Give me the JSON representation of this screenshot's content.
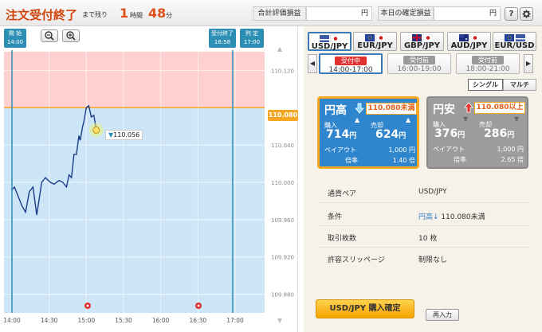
{
  "header": {
    "title": "注文受付終了",
    "remaining_label": "まで残り",
    "hours": "1",
    "hours_unit": "時間",
    "minutes": "48",
    "minutes_unit": "分",
    "total_pl_label": "合計評価損益",
    "total_pl_value": "円",
    "today_pl_label": "本日の確定損益",
    "today_pl_value": "円",
    "help_label": "?",
    "settings_icon": "gear-icon"
  },
  "chart": {
    "zoom_out_icon": "zoom-out-icon",
    "zoom_in_icon": "zoom-in-icon",
    "start_marker": {
      "label": "開 始",
      "time": "14:00"
    },
    "end_accept_marker": {
      "label": "受付終了",
      "time": "16:58"
    },
    "judge_marker": {
      "label": "判 定",
      "time": "17:00"
    },
    "current_rate": "110.080",
    "entry_rate": "110.056",
    "y_ticks": [
      "110.120",
      "110.080",
      "110.040",
      "110.000",
      "109.960",
      "109.920",
      "109.880"
    ],
    "x_ticks": [
      "14:00",
      "14:30",
      "15:00",
      "15:30",
      "16:00",
      "16:30",
      "17:00"
    ],
    "colors": {
      "upper_zone": "#ffd0d0",
      "lower_zone": "#cde6f7",
      "line": "#1a3a8a",
      "marker": "#2e8fb5",
      "threshold": "#f5a623"
    }
  },
  "chart_data": {
    "type": "line",
    "title": "",
    "xlabel": "",
    "ylabel": "",
    "ylim": [
      109.86,
      110.14
    ],
    "x": [
      "14:00",
      "14:02",
      "14:05",
      "14:08",
      "14:11",
      "14:14",
      "14:17",
      "14:20",
      "14:24",
      "14:27",
      "14:31",
      "14:34",
      "14:38",
      "14:41",
      "14:44",
      "14:46",
      "14:48",
      "14:50",
      "14:52",
      "14:54",
      "14:55",
      "14:57",
      "14:58",
      "15:00",
      "15:02",
      "15:04",
      "15:06",
      "15:08"
    ],
    "values": [
      109.992,
      109.995,
      109.985,
      109.975,
      109.968,
      109.99,
      109.995,
      109.965,
      110.0,
      110.005,
      110.0,
      109.998,
      110.002,
      110.0,
      109.995,
      110.008,
      110.005,
      110.03,
      110.03,
      110.05,
      110.045,
      110.06,
      110.065,
      110.08,
      110.082,
      110.07,
      110.072,
      110.056
    ],
    "threshold": 110.08
  },
  "currency_pairs": [
    {
      "label": "USD/JPY",
      "selected": true
    },
    {
      "label": "EUR/JPY",
      "selected": false
    },
    {
      "label": "GBP/JPY",
      "selected": false
    },
    {
      "label": "AUD/JPY",
      "selected": false
    },
    {
      "label": "EUR/USD",
      "selected": false
    }
  ],
  "sessions": [
    {
      "status": "受付中",
      "time": "14:00-17:00",
      "selected": true
    },
    {
      "status": "受付前",
      "time": "16:00-19:00",
      "selected": false
    },
    {
      "status": "受付前",
      "time": "18:00-21:00",
      "selected": false
    }
  ],
  "mode": {
    "single": "シングル",
    "multi": "マルチ"
  },
  "high_card": {
    "title": "円高",
    "threshold": "110.080未満",
    "buy_label": "購入",
    "sell_label": "売却",
    "buy_price": "714",
    "sell_price": "624",
    "yen": "円",
    "payout_label": "ペイアウト",
    "payout_value": "1,000 円",
    "ratio_label": "倍率",
    "ratio_value": "1.40 倍"
  },
  "low_card": {
    "title": "円安",
    "threshold": "110.080以上",
    "buy_label": "購入",
    "sell_label": "売却",
    "buy_price": "376",
    "sell_price": "286",
    "yen": "円",
    "payout_label": "ペイアウト",
    "payout_value": "1,000 円",
    "ratio_label": "倍率",
    "ratio_value": "2.65 倍"
  },
  "order_info": {
    "pair_label": "通貨ペア",
    "pair_value": "USD/JPY",
    "cond_label": "条件",
    "cond_dir": "円高↓",
    "cond_value": "110.080未満",
    "qty_label": "取引枚数",
    "qty_value": "10 枚",
    "slip_label": "許容スリッページ",
    "slip_value": "制限なし"
  },
  "actions": {
    "confirm": "USD/JPY 購入確定",
    "reset": "再入力"
  }
}
